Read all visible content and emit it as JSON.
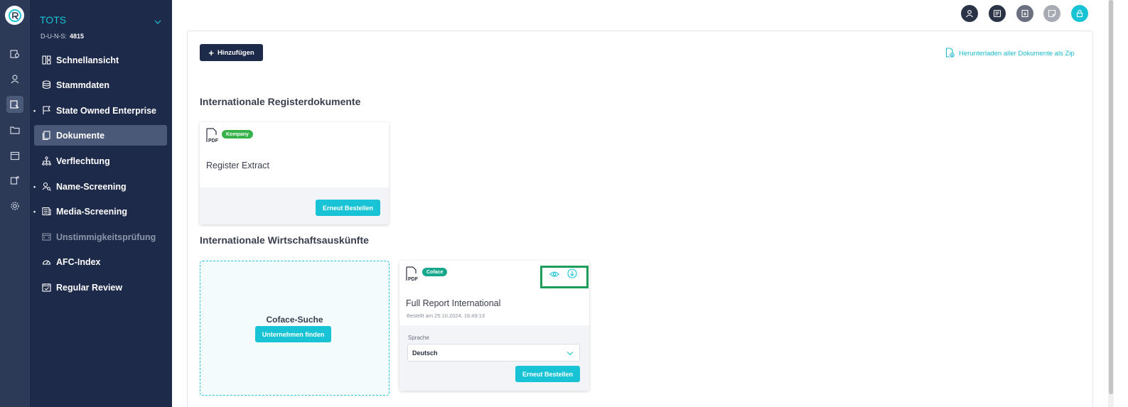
{
  "sidebar": {
    "company_name": "TOTS",
    "duns_label": "D-U-N-S:",
    "duns_value": "4815",
    "items": [
      {
        "label": "Schnellansicht"
      },
      {
        "label": "Stammdaten"
      },
      {
        "label": "State Owned Enterprise"
      },
      {
        "label": "Dokumente"
      },
      {
        "label": "Verflechtung"
      },
      {
        "label": "Name-Screening"
      },
      {
        "label": "Media-Screening"
      },
      {
        "label": "Unstimmigkeitsprüfung"
      },
      {
        "label": "AFC-Index"
      },
      {
        "label": "Regular Review"
      }
    ],
    "active_item": "Dokumente"
  },
  "toolbar": {
    "add_label": "Hinzufügen",
    "download_zip_label": "Herunterladen aller Dokumente als Zip"
  },
  "sections": {
    "register": {
      "title": "Internationale Registerdokumente",
      "card": {
        "badge": "Kompany",
        "title": "Register Extract",
        "button": "Erneut Bestellen"
      }
    },
    "economic": {
      "title": "Internationale Wirtschaftsauskünfte",
      "search_card": {
        "title": "Coface-Suche",
        "button": "Unternehmen finden"
      },
      "report_card": {
        "badge": "Coface",
        "title": "Full Report International",
        "ordered": "Bestellt am 25.10.2024, 16:49:13",
        "language_label": "Sprache",
        "language_value": "Deutsch",
        "button": "Erneut Bestellen"
      }
    }
  },
  "colors": {
    "sidebar_bg": "#1e2a4a",
    "rail_bg": "#2c3a57",
    "accent": "#17c3d5",
    "kompany_badge": "#36b24a",
    "coface_badge": "#17a88c",
    "highlight": "#1e9c5a"
  }
}
